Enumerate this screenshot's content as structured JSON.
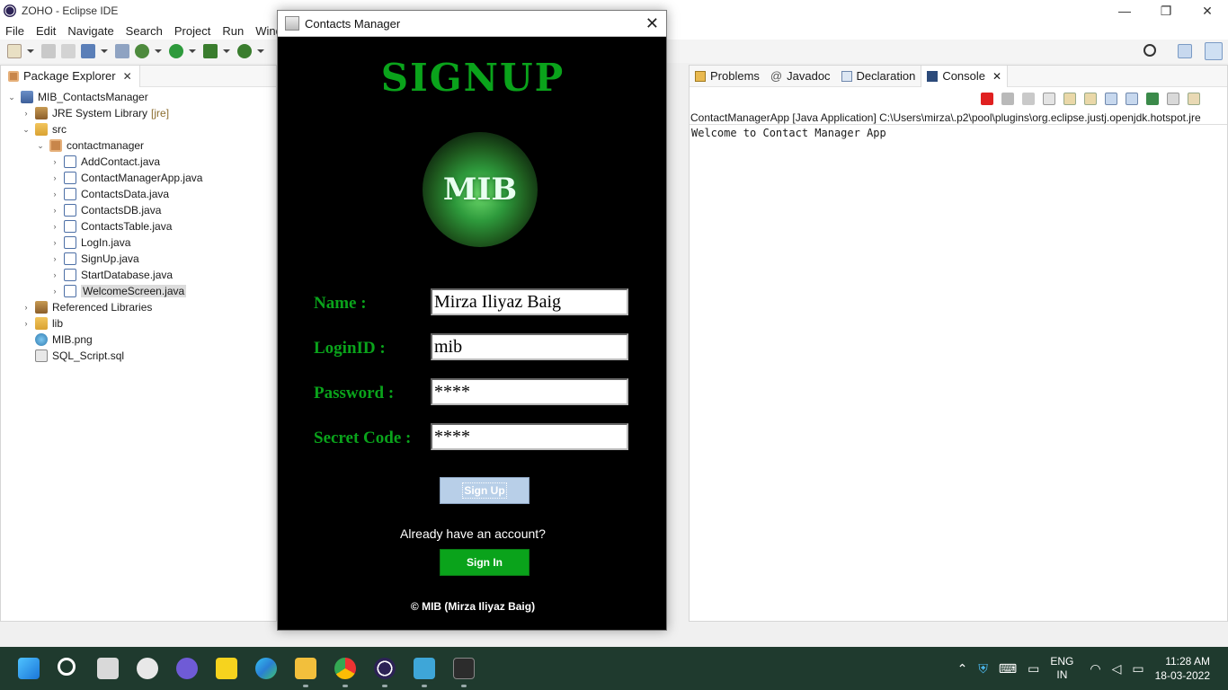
{
  "window": {
    "title": "ZOHO - Eclipse IDE",
    "minimize": "—",
    "restore": "❐",
    "close": "✕"
  },
  "menu": [
    "File",
    "Edit",
    "Navigate",
    "Search",
    "Project",
    "Run",
    "Window"
  ],
  "package_explorer": {
    "tab_label": "Package Explorer",
    "close": "✕",
    "tree": [
      {
        "label": "MIB_ContactsManager",
        "icon": "project-icon",
        "depth": 0,
        "twisty": "⌄"
      },
      {
        "label": "JRE System Library",
        "extra": "[jre]",
        "icon": "library-icon",
        "depth": 1,
        "twisty": "›"
      },
      {
        "label": "src",
        "icon": "folder-icon",
        "depth": 1,
        "twisty": "⌄"
      },
      {
        "label": "contactmanager",
        "icon": "package-icon",
        "depth": 2,
        "twisty": "⌄"
      },
      {
        "label": "AddContact.java",
        "icon": "java-file-icon",
        "depth": 3,
        "twisty": "›"
      },
      {
        "label": "ContactManagerApp.java",
        "icon": "java-file-icon",
        "depth": 3,
        "twisty": "›"
      },
      {
        "label": "ContactsData.java",
        "icon": "java-file-icon",
        "depth": 3,
        "twisty": "›"
      },
      {
        "label": "ContactsDB.java",
        "icon": "java-file-icon",
        "depth": 3,
        "twisty": "›"
      },
      {
        "label": "ContactsTable.java",
        "icon": "java-file-icon",
        "depth": 3,
        "twisty": "›"
      },
      {
        "label": "LogIn.java",
        "icon": "java-file-icon",
        "depth": 3,
        "twisty": "›"
      },
      {
        "label": "SignUp.java",
        "icon": "java-file-icon",
        "depth": 3,
        "twisty": "›"
      },
      {
        "label": "StartDatabase.java",
        "icon": "java-file-icon",
        "depth": 3,
        "twisty": "›"
      },
      {
        "label": "WelcomeScreen.java",
        "icon": "java-file-icon",
        "depth": 3,
        "twisty": "›",
        "selected": true
      },
      {
        "label": "Referenced Libraries",
        "icon": "library-icon",
        "depth": 1,
        "twisty": "›"
      },
      {
        "label": "lib",
        "icon": "folder-icon",
        "depth": 1,
        "twisty": "›"
      },
      {
        "label": "MIB.png",
        "icon": "image-file-icon",
        "depth": 1,
        "twisty": ""
      },
      {
        "label": "SQL_Script.sql",
        "icon": "sql-file-icon",
        "depth": 1,
        "twisty": ""
      }
    ]
  },
  "console_panel": {
    "tabs": [
      {
        "label": "Problems",
        "icon": "problems-icon"
      },
      {
        "label": "Javadoc",
        "icon": "javadoc-icon",
        "prefix": "@"
      },
      {
        "label": "Declaration",
        "icon": "declaration-icon"
      },
      {
        "label": "Console",
        "icon": "console-icon",
        "active": true
      }
    ],
    "close": "✕",
    "header": "ContactManagerApp [Java Application] C:\\Users\\mirza\\.p2\\pool\\plugins\\org.eclipse.justj.openjdk.hotspot.jre",
    "output": "Welcome to Contact Manager App"
  },
  "dialog": {
    "title": "Contacts Manager",
    "close": "✕",
    "heading": "SIGNUP",
    "logo_text": "MIB",
    "fields": [
      {
        "label": "Name :",
        "value": "Mirza Iliyaz Baig"
      },
      {
        "label": "LoginID :",
        "value": "mib"
      },
      {
        "label": "Password :",
        "value": "****"
      },
      {
        "label": "Secret Code :",
        "value": "****"
      }
    ],
    "signup_button": "Sign Up",
    "already_text": "Already have an account?",
    "signin_button": "Sign In",
    "copyright": "© MIB (Mirza Iliyaz Baig)",
    "colors": {
      "accent": "#0aa31b",
      "background": "#000000",
      "signup_button": "#b8cfe8"
    }
  },
  "taskbar": {
    "lang_line1": "ENG",
    "lang_line2": "IN",
    "time": "11:28 AM",
    "date": "18-03-2022"
  }
}
